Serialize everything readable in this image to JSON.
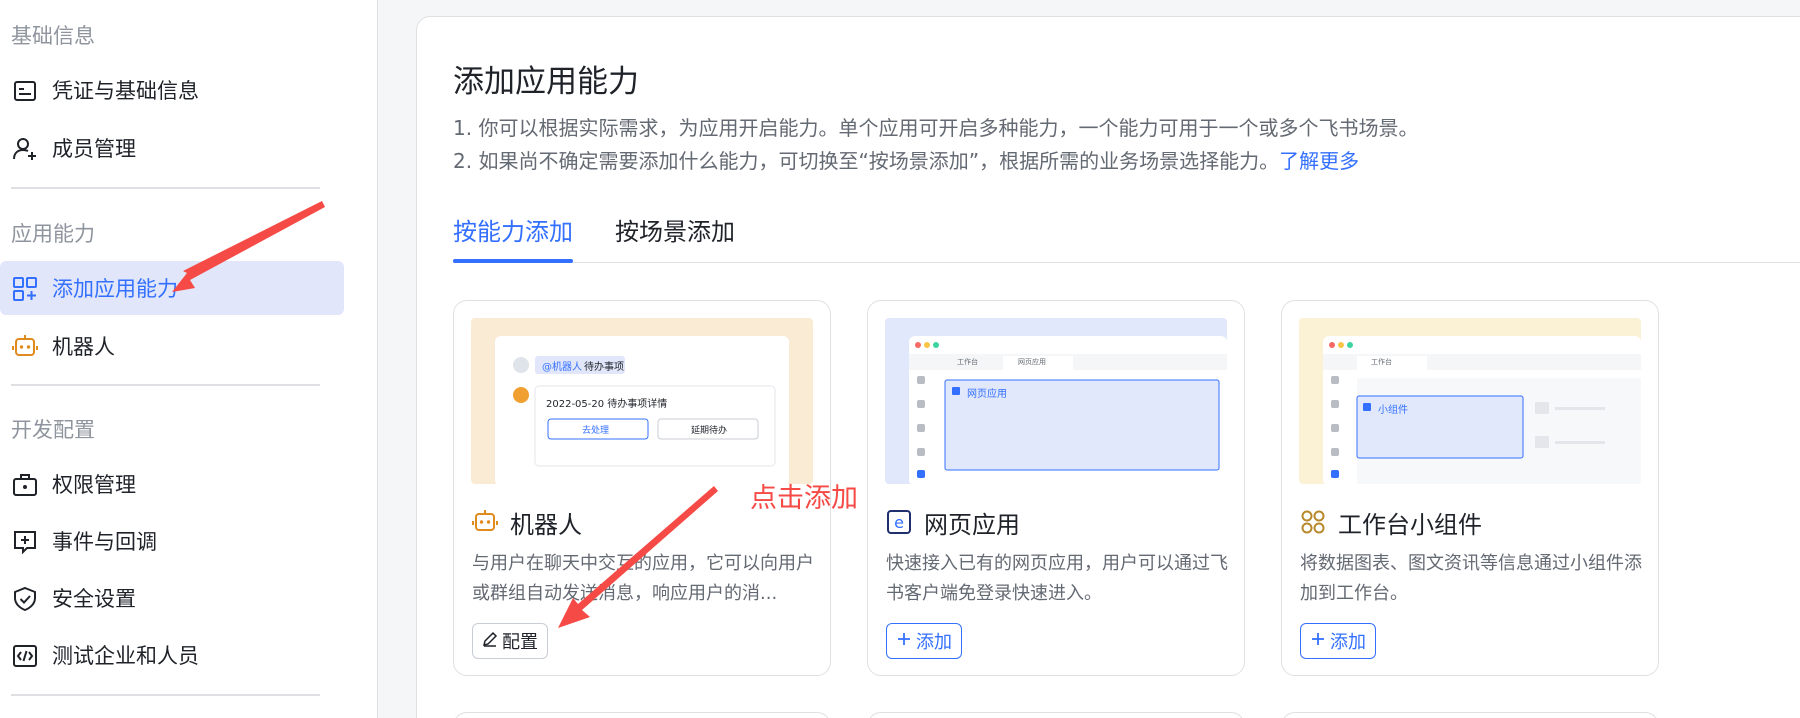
{
  "sidebar": {
    "sections": [
      {
        "title": "基础信息",
        "items": [
          {
            "label": "凭证与基础信息",
            "icon": "credential-icon"
          },
          {
            "label": "成员管理",
            "icon": "user-add-icon"
          }
        ]
      },
      {
        "title": "应用能力",
        "items": [
          {
            "label": "添加应用能力",
            "icon": "app-add-icon",
            "active": true
          },
          {
            "label": "机器人",
            "icon": "robot-icon"
          }
        ]
      },
      {
        "title": "开发配置",
        "items": [
          {
            "label": "权限管理",
            "icon": "permission-icon"
          },
          {
            "label": "事件与回调",
            "icon": "event-icon"
          },
          {
            "label": "安全设置",
            "icon": "shield-icon"
          },
          {
            "label": "测试企业和人员",
            "icon": "code-icon"
          }
        ]
      }
    ]
  },
  "main": {
    "title": "添加应用能力",
    "desc_line1": "1. 你可以根据实际需求，为应用开启能力。单个应用可开启多种能力，一个能力可用于一个或多个飞书场景。",
    "desc_line2": "2. 如果尚不确定需要添加什么能力，可切换至“按场景添加”，根据所需的业务场景选择能力。",
    "learn_more": "了解更多",
    "tabs": [
      {
        "label": "按能力添加",
        "active": true
      },
      {
        "label": "按场景添加",
        "active": false
      }
    ],
    "cards": [
      {
        "title": "机器人",
        "desc": "与用户在聊天中交互的应用，它可以向用户或群组自动发送消息，响应用户的消...",
        "button": "配置",
        "thumb": {
          "mention": "@机器人",
          "todo": "待办事项",
          "date_line": "2022-05-20 待办事项详情",
          "btn_primary": "去处理",
          "btn_secondary": "延期待办"
        }
      },
      {
        "title": "网页应用",
        "desc": "快速接入已有的网页应用，用户可以通过飞书客户端免登录快速进入。",
        "button": "添加",
        "thumb": {
          "tab1": "工作台",
          "tab2": "网页应用",
          "panel": "网页应用"
        }
      },
      {
        "title": "工作台小组件",
        "desc": "将数据图表、图文资讯等信息通过小组件添加到工作台。",
        "button": "添加",
        "thumb": {
          "tab1": "工作台",
          "panel": "小组件"
        }
      }
    ],
    "annotation": "点击添加"
  },
  "colors": {
    "accent": "#3370ff",
    "active_bg": "#e1e6fa",
    "annotation": "#f54a45",
    "robot_orange": "#e08b1e"
  }
}
